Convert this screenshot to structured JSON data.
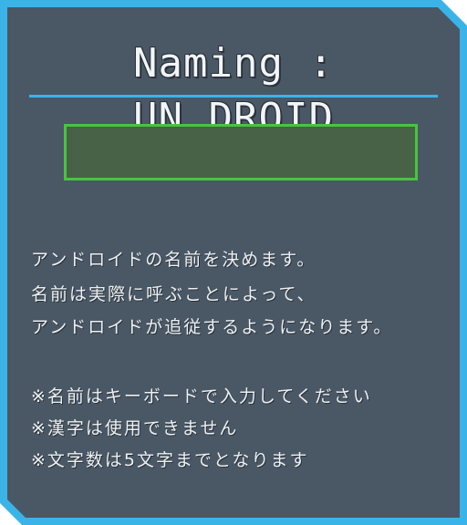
{
  "dialog": {
    "title": "Naming : UN.DROID",
    "name_input": {
      "value": "",
      "placeholder": ""
    },
    "description_lines": [
      "アンドロイドの名前を決めます。",
      "名前は実際に呼ぶことによって、",
      "アンドロイドが追従するようになります。"
    ],
    "notes": [
      "※名前はキーボードで入力してください",
      "※漢字は使用できません",
      "※文字数は5文字までとなります"
    ]
  },
  "colors": {
    "panel_bg": "#4a5866",
    "frame_accent": "#3ab4e8",
    "input_bg": "#476246",
    "input_border": "#47c53e",
    "text": "#eef1f3"
  }
}
